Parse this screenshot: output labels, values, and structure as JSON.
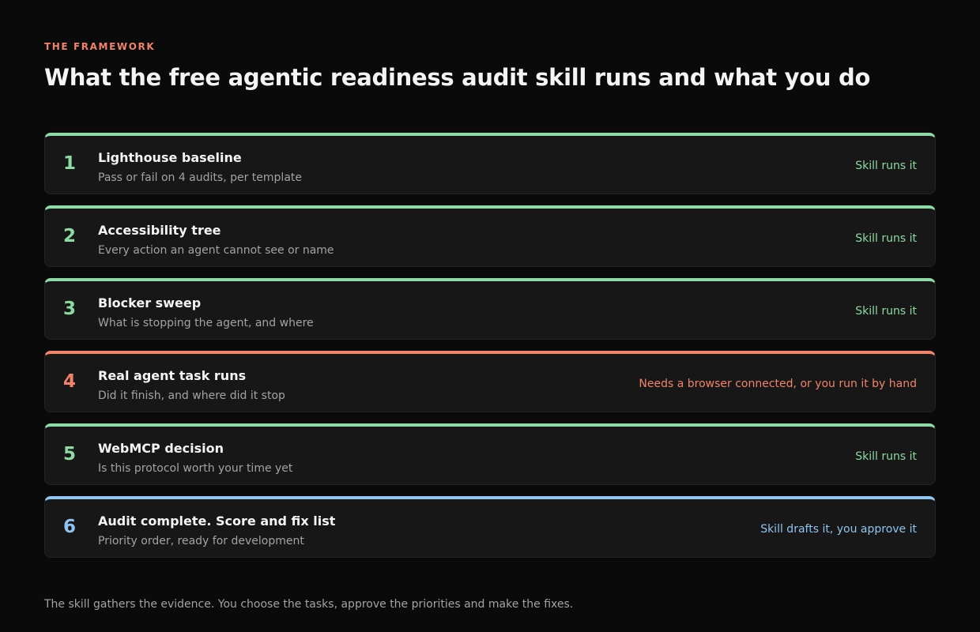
{
  "header": {
    "eyebrow": "THE FRAMEWORK",
    "title": "What the free agentic readiness audit skill runs and what you do"
  },
  "colors": {
    "background": "#0a0a0a",
    "card": "#171717",
    "green": "#8ddaa4",
    "coral": "#f0836a",
    "blue": "#8fc4ef"
  },
  "steps": [
    {
      "number": "1",
      "title": "Lighthouse baseline",
      "description": "Pass or fail on 4 audits, per template",
      "status": "Skill runs it"
    },
    {
      "number": "2",
      "title": "Accessibility tree",
      "description": "Every action an agent cannot see or name",
      "status": "Skill runs it"
    },
    {
      "number": "3",
      "title": "Blocker sweep",
      "description": "What is stopping the agent, and where",
      "status": "Skill runs it"
    },
    {
      "number": "4",
      "title": "Real agent task runs",
      "description": "Did it finish, and where did it stop",
      "status": "Needs a browser connected, or you run it by hand"
    },
    {
      "number": "5",
      "title": "WebMCP decision",
      "description": "Is this protocol worth your time yet",
      "status": "Skill runs it"
    },
    {
      "number": "6",
      "title": "Audit complete. Score and fix list",
      "description": "Priority order, ready for development",
      "status": "Skill drafts it, you approve it"
    }
  ],
  "footer": {
    "text": "The skill gathers the evidence. You choose the tasks, approve the priorities and make the fixes."
  }
}
